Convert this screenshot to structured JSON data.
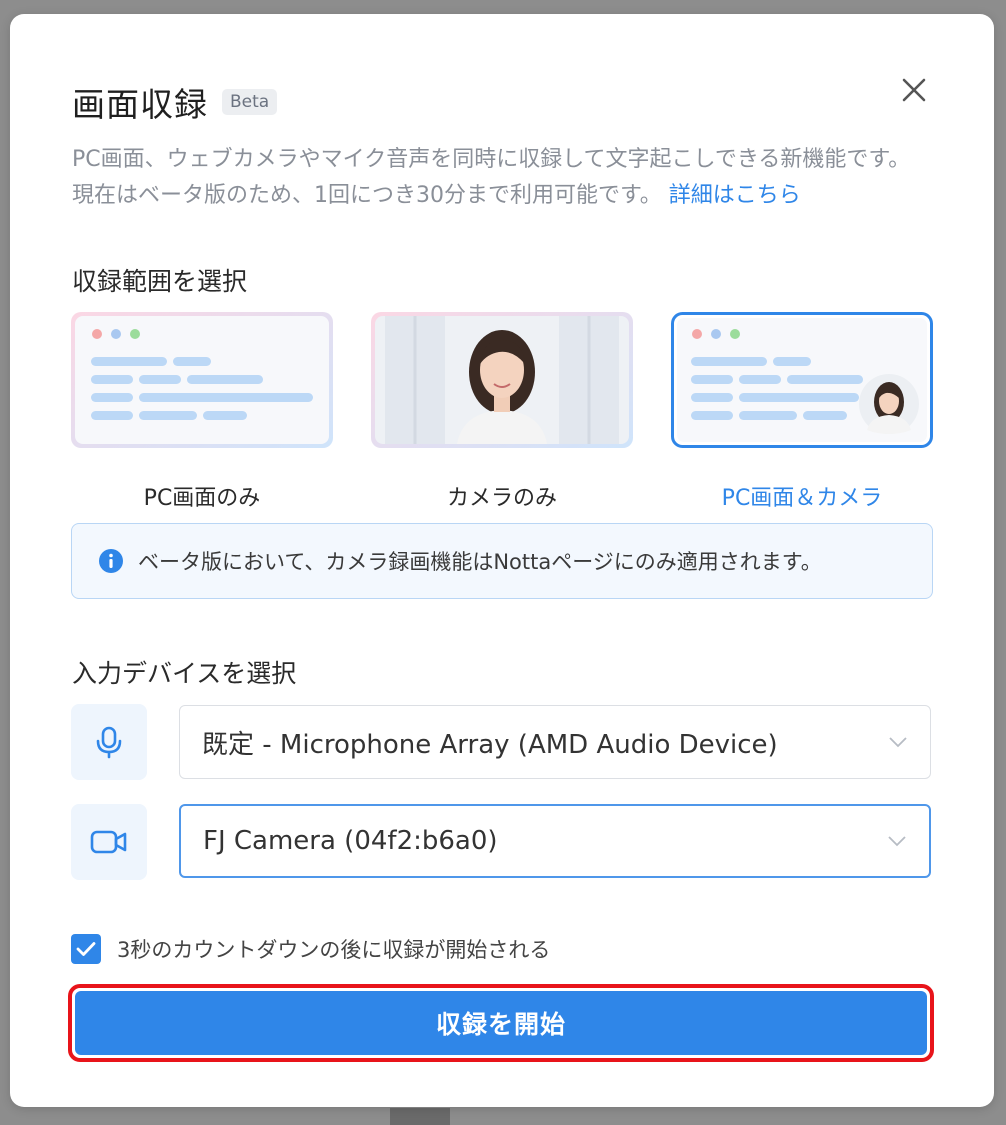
{
  "dialog": {
    "title": "画面収録",
    "badge": "Beta",
    "description": "PC画面、ウェブカメラやマイク音声を同時に収録して文字起こしできる新機能です。現在はベータ版のため、1回につき30分まで利用可能です。",
    "details_link": "詳細はこちら"
  },
  "range_section": {
    "title": "収録範囲を選択",
    "options": [
      {
        "label": "PC画面のみ",
        "selected": false
      },
      {
        "label": "カメラのみ",
        "selected": false
      },
      {
        "label": "PC画面＆カメラ",
        "selected": true
      }
    ]
  },
  "info": {
    "text": "ベータ版において、カメラ録画機能はNottaページにのみ適用されます。",
    "icon": "info-icon"
  },
  "device_section": {
    "title": "入力デバイスを選択",
    "microphone": {
      "value": "既定 - Microphone Array (AMD Audio Device)",
      "icon": "microphone-icon"
    },
    "camera": {
      "value": "FJ Camera (04f2:b6a0)",
      "icon": "video-camera-icon"
    }
  },
  "countdown": {
    "checked": true,
    "label": "3秒のカウントダウンの後に収録が開始される"
  },
  "start_button": {
    "label": "収録を開始"
  },
  "colors": {
    "accent": "#2f86e8",
    "highlight_border": "#e8141a",
    "info_bg": "#f3f8fe"
  }
}
